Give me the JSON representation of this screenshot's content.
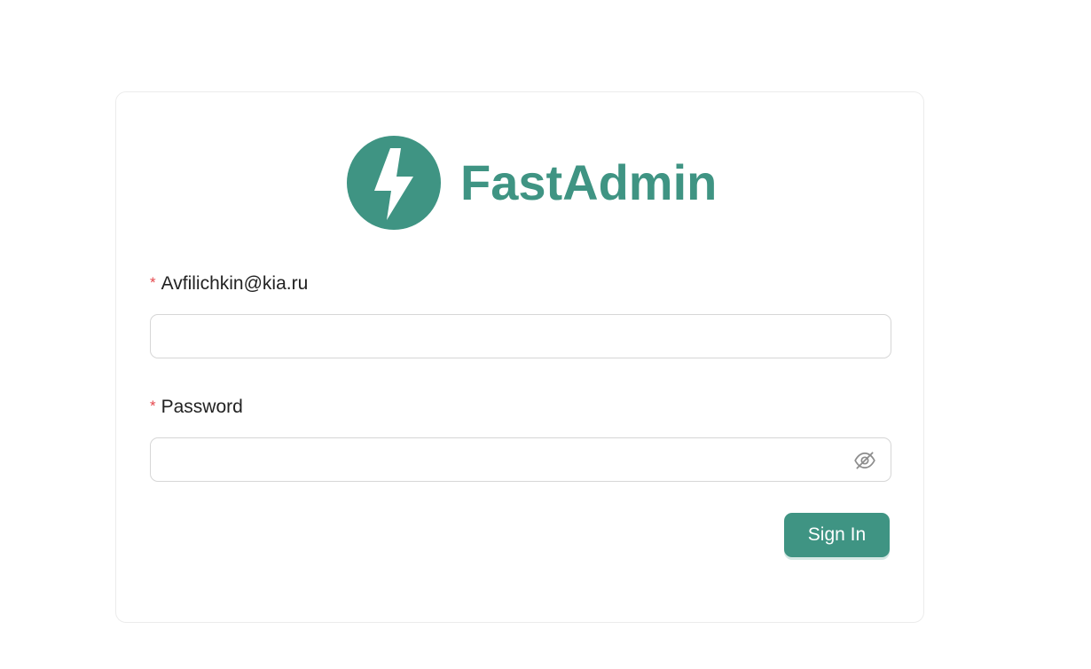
{
  "app": {
    "brand_name": "FastAdmin",
    "logo_icon": "lightning-bolt-icon",
    "accent_color": "#3f9483"
  },
  "form": {
    "email_field": {
      "label": "Avfilichkin@kia.ru",
      "required_mark": "*",
      "value": "",
      "placeholder": ""
    },
    "password_field": {
      "label": "Password",
      "required_mark": "*",
      "value": "",
      "placeholder": "",
      "toggle_icon": "eye-off-icon"
    },
    "submit_label": "Sign In"
  },
  "colors": {
    "required": "#e5484d",
    "border": "#d6d6d6"
  }
}
